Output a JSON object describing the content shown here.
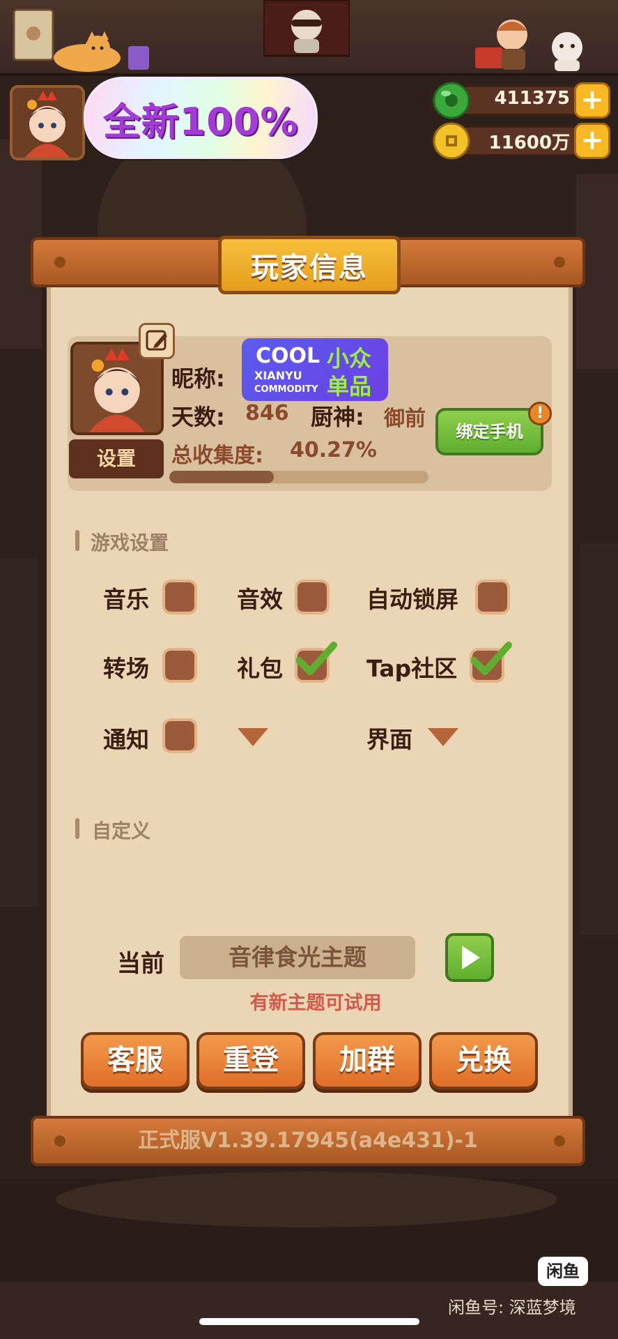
{
  "colors": {
    "accent_orange": "#df6f2a",
    "title_gold": "#f7bf3b",
    "paper": "#ead5b4",
    "green_button": "#5fae30",
    "promo_purple": "#a43bd6",
    "warning_text": "#d05a4e"
  },
  "hud": {
    "promo_text": "全新100%",
    "jade_value": "411375",
    "coin_value": "11600万",
    "jade_icon": "jade-coin-icon",
    "coin_icon": "gold-coin-icon",
    "plus": "+"
  },
  "panel": {
    "title": "玩家信息",
    "profile": {
      "nickname_label": "昵称:",
      "badge_cool": "COOL",
      "badge_small": "小众",
      "badge_xianyu": "XIANYU",
      "badge_single": "单品",
      "badge_commodity": "COMMODITY",
      "days_label": "天数:",
      "days_value": "846",
      "chef_label": "厨神:",
      "chef_value": "御前",
      "collection_label": "总收集度:",
      "collection_value": "40.27%",
      "collection_progress": 0.4027,
      "settings_button": "设置",
      "bind_phone_button": "绑定手机",
      "alert_mark": "!"
    },
    "game_settings": {
      "title": "游戏设置",
      "options": [
        {
          "label": "音乐",
          "checked": false
        },
        {
          "label": "音效",
          "checked": false
        },
        {
          "label": "自动锁屏",
          "checked": false
        },
        {
          "label": "转场",
          "checked": false
        },
        {
          "label": "礼包",
          "checked": true
        },
        {
          "label": "Tap社区",
          "checked": true
        },
        {
          "label": "通知",
          "checked": false
        }
      ],
      "interface_label": "界面"
    },
    "custom": {
      "title": "自定义",
      "current_label": "当前",
      "current_theme": "音律食光主题",
      "new_theme_hint": "有新主题可试用"
    },
    "actions": [
      "客服",
      "重登",
      "加群",
      "兑换"
    ],
    "version": "正式服V1.39.17945(a4e431)-1"
  },
  "footer": {
    "app_logo": "闲鱼",
    "watermark": "闲鱼号: 深蓝梦境"
  }
}
